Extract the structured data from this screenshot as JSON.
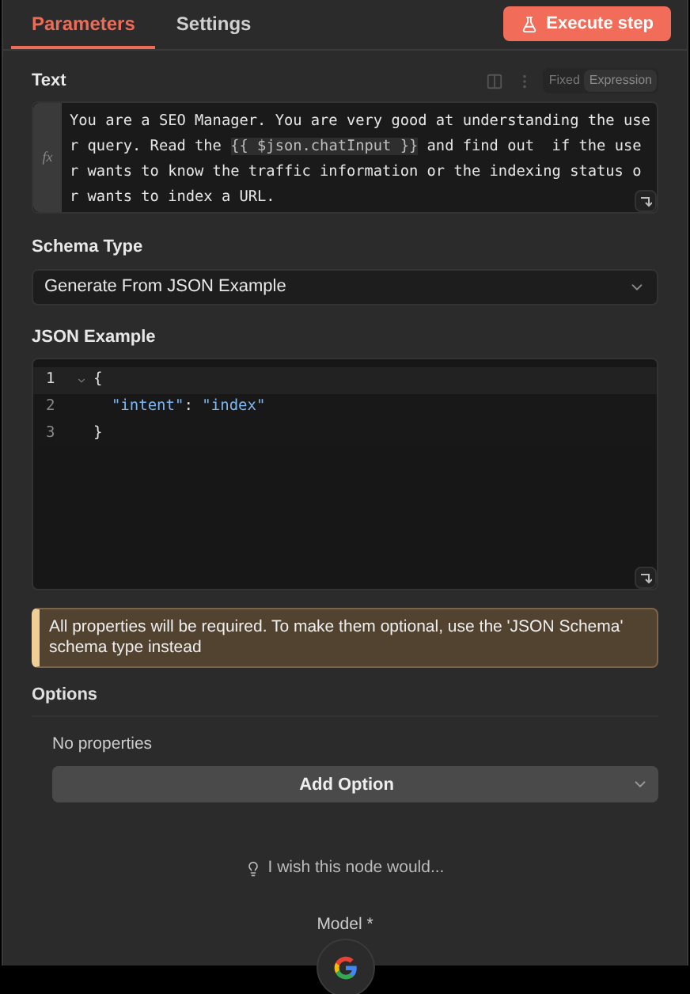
{
  "tabs": [
    {
      "label": "Parameters",
      "selected": true
    },
    {
      "label": "Settings",
      "selected": false
    }
  ],
  "execute_button": "Execute step",
  "text_field": {
    "label": "Text",
    "mode_options": [
      {
        "label": "Fixed",
        "selected": false
      },
      {
        "label": "Expression",
        "selected": true
      }
    ],
    "fx_badge": "fx",
    "lines": [
      [
        {
          "kind": "plain",
          "text": "You are a SEO Manager. You are very good at understanding the use"
        }
      ],
      [
        {
          "kind": "plain",
          "text": "r query. Read the "
        },
        {
          "kind": "expression",
          "text": "{{ $json.chatInput }}"
        },
        {
          "kind": "plain",
          "text": " and find out  if the use"
        }
      ],
      [
        {
          "kind": "plain",
          "text": "r wants to know the traffic information or the indexing status o"
        }
      ],
      [
        {
          "kind": "plain",
          "text": "r wants to index a URL."
        }
      ]
    ]
  },
  "schema_type": {
    "label": "Schema Type",
    "value": "Generate From JSON Example"
  },
  "json_example": {
    "label": "JSON Example",
    "lines": [
      {
        "number": "1",
        "active": true,
        "foldable": true,
        "tokens": [
          {
            "kind": "punct",
            "text": "{"
          }
        ]
      },
      {
        "number": "2",
        "active": false,
        "foldable": false,
        "tokens": [
          {
            "kind": "string",
            "text": "  \"intent\""
          },
          {
            "kind": "punct",
            "text": ": "
          },
          {
            "kind": "string",
            "text": "\"index\""
          }
        ]
      },
      {
        "number": "3",
        "active": false,
        "foldable": false,
        "tokens": [
          {
            "kind": "punct",
            "text": "}"
          }
        ]
      }
    ]
  },
  "warning": "All properties will be required. To make them optional, use the 'JSON Schema' schema type instead",
  "options": {
    "label": "Options",
    "empty_text": "No properties",
    "add_button": "Add Option"
  },
  "feedback_link": "I wish this node would...",
  "model_label": "Model *"
}
